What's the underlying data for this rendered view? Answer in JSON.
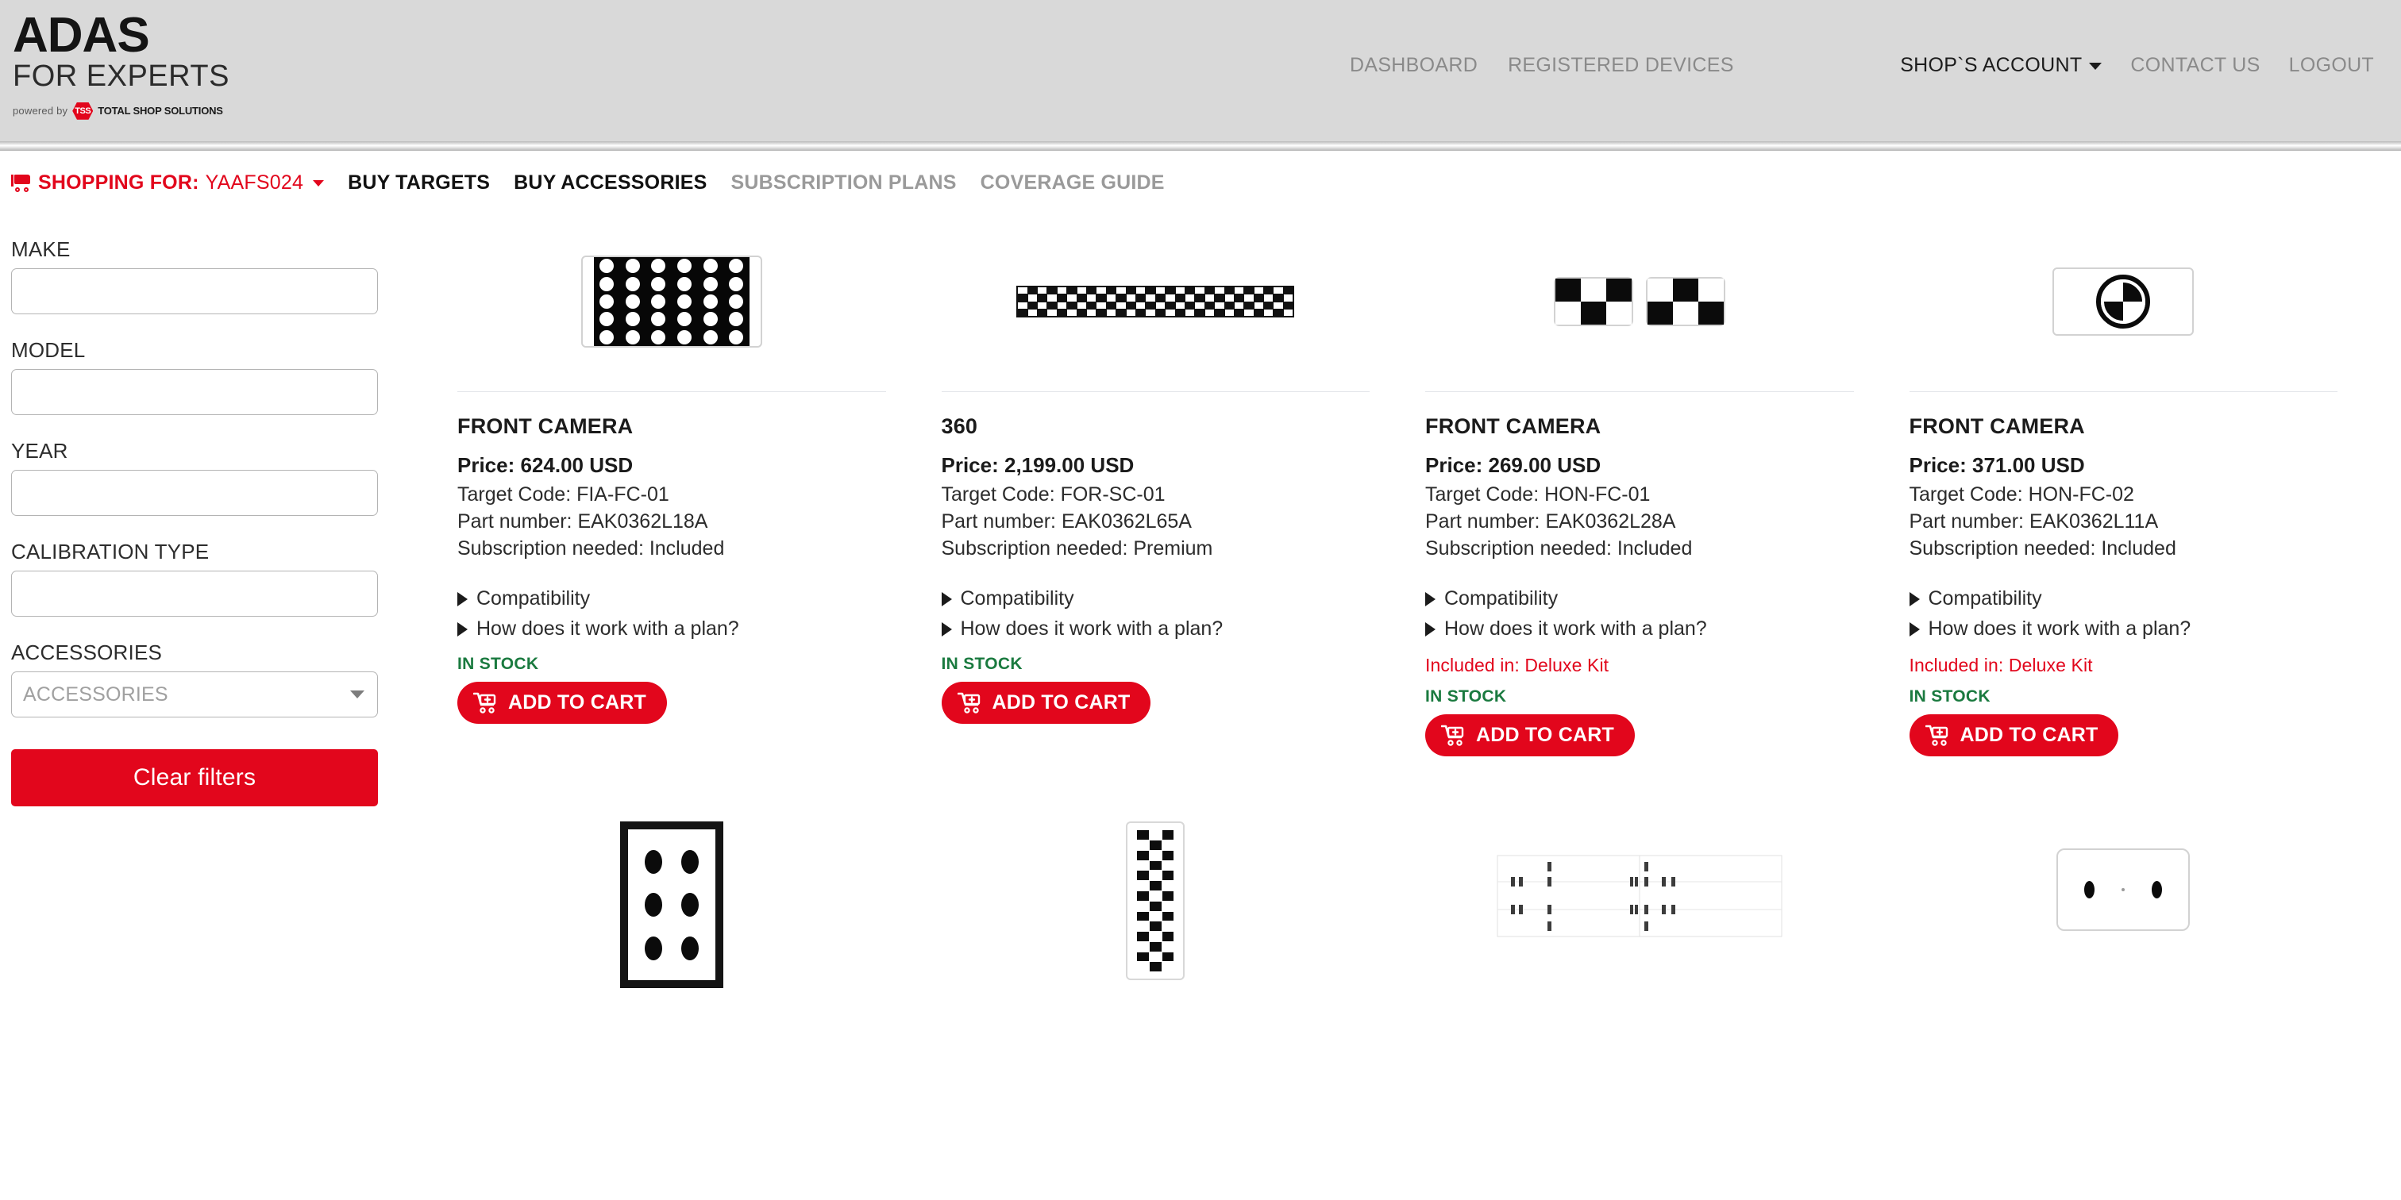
{
  "header": {
    "logo": {
      "line1": "ADAS",
      "line2": "FOR EXPERTS",
      "powered_by": "powered by",
      "badge": "TSS",
      "partner": "TOTAL SHOP SOLUTIONS"
    },
    "nav_left": [
      {
        "label": "DASHBOARD",
        "active": false
      },
      {
        "label": "REGISTERED DEVICES",
        "active": false
      }
    ],
    "nav_right": [
      {
        "label": "SHOP`S ACCOUNT",
        "active": true,
        "caret": true
      },
      {
        "label": "CONTACT US",
        "active": false,
        "caret": false
      },
      {
        "label": "LOGOUT",
        "active": false,
        "caret": false
      }
    ]
  },
  "subnav": {
    "shopping_for_label": "SHOPPING FOR:",
    "device_id": "YAAFS024",
    "cart_icon": "shopping-cart-icon",
    "links": [
      {
        "label": "BUY TARGETS",
        "state": "active"
      },
      {
        "label": "BUY ACCESSORIES",
        "state": "active"
      },
      {
        "label": "SUBSCRIPTION PLANS",
        "state": "muted"
      },
      {
        "label": "COVERAGE GUIDE",
        "state": "muted"
      }
    ]
  },
  "filters": {
    "make": {
      "label": "MAKE",
      "value": "",
      "placeholder": ""
    },
    "model": {
      "label": "MODEL",
      "value": "",
      "placeholder": ""
    },
    "year": {
      "label": "YEAR",
      "value": "",
      "placeholder": ""
    },
    "calibration_type": {
      "label": "CALIBRATION TYPE",
      "value": "",
      "placeholder": ""
    },
    "accessories": {
      "label": "ACCESSORIES",
      "selected": "ACCESSORIES"
    },
    "clear_button": "Clear filters"
  },
  "labels": {
    "price_prefix": "Price:",
    "target_code_prefix": "Target Code:",
    "part_number_prefix": "Part number:",
    "subscription_prefix": "Subscription needed:",
    "compatibility": "Compatibility",
    "how_it_works": "How does it work with a plan?",
    "in_stock": "IN STOCK",
    "add_to_cart": "ADD TO CART",
    "cart_icon": "cart-plus-icon"
  },
  "colors": {
    "brand_red": "#e2061c",
    "in_stock_green": "#1a7a3f",
    "header_gray": "#d9d9d9",
    "muted_text": "#9a9a9a"
  },
  "products": [
    {
      "title": "FRONT CAMERA",
      "price": "Price: 624.00 USD",
      "target_code": "Target Code: FIA-FC-01",
      "part_number": "Part number: EAK0362L18A",
      "subscription": "Subscription needed: Included",
      "included_in": "",
      "stock": "IN STOCK",
      "art": "dot-grid-panel"
    },
    {
      "title": "360",
      "price": "Price: 2,199.00 USD",
      "target_code": "Target Code: FOR-SC-01",
      "part_number": "Part number: EAK0362L65A",
      "subscription": "Subscription needed: Premium",
      "included_in": "",
      "stock": "IN STOCK",
      "art": "checker-strip"
    },
    {
      "title": "FRONT CAMERA",
      "price": "Price: 269.00 USD",
      "target_code": "Target Code: HON-FC-01",
      "part_number": "Part number: EAK0362L28A",
      "subscription": "Subscription needed: Included",
      "included_in": "Included in: Deluxe Kit",
      "stock": "IN STOCK",
      "art": "dual-checker-plates"
    },
    {
      "title": "FRONT CAMERA",
      "price": "Price: 371.00 USD",
      "target_code": "Target Code: HON-FC-02",
      "part_number": "Part number: EAK0362L11A",
      "subscription": "Subscription needed: Included",
      "included_in": "Included in: Deluxe Kit",
      "stock": "IN STOCK",
      "art": "roundel-logo"
    }
  ],
  "products_row2": [
    {
      "art": "vertical-dot-frame"
    },
    {
      "art": "vertical-checker-strip"
    },
    {
      "art": "wide-faint-diagram"
    },
    {
      "art": "two-dot-plate"
    }
  ]
}
